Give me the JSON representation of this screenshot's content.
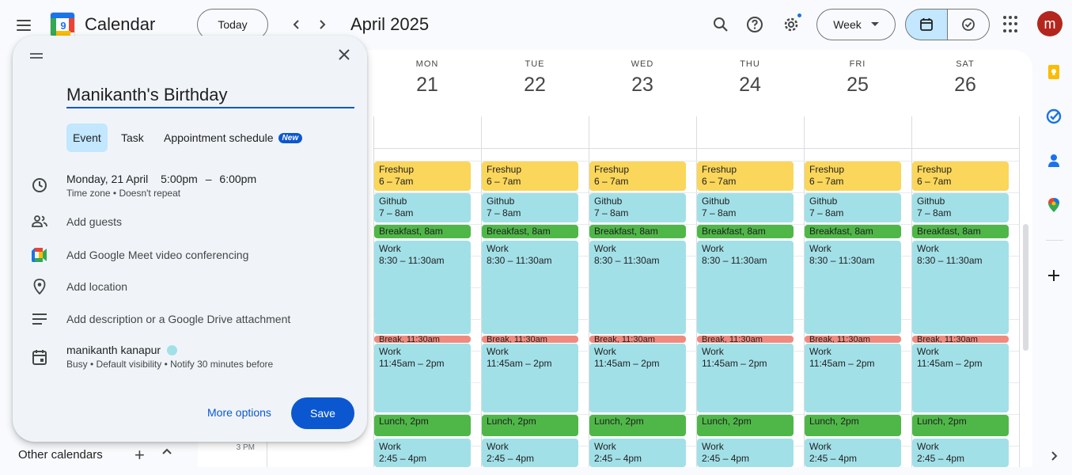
{
  "header": {
    "app_title": "Calendar",
    "logo_day": "9",
    "today_label": "Today",
    "month_title": "April 2025",
    "view_label": "Week",
    "avatar_letter": "m"
  },
  "days": [
    {
      "name": "MON",
      "num": "21"
    },
    {
      "name": "TUE",
      "num": "22"
    },
    {
      "name": "WED",
      "num": "23"
    },
    {
      "name": "THU",
      "num": "24"
    },
    {
      "name": "FRI",
      "num": "25"
    },
    {
      "name": "SAT",
      "num": "26"
    }
  ],
  "time_labels": [
    "3 PM"
  ],
  "events": [
    {
      "title": "Freshup",
      "time": "6 – 7am",
      "color": "yellow"
    },
    {
      "title": "Github",
      "time": "7 – 8am",
      "color": "cyan"
    },
    {
      "title": "Breakfast",
      "time": "8am",
      "color": "green"
    },
    {
      "title": "Work",
      "time": "8:30 – 11:30am",
      "color": "cyan"
    },
    {
      "title": "Break",
      "time": "11:30am",
      "color": "red"
    },
    {
      "title": "Work",
      "time": "11:45am – 2pm",
      "color": "cyan"
    },
    {
      "title": "Lunch",
      "time": "2pm",
      "color": "green"
    },
    {
      "title": "Work",
      "time": "2:45 – 4pm",
      "color": "cyan"
    }
  ],
  "event_colors": {
    "yellow": "#fad65b",
    "cyan": "#a2e0e8",
    "green": "#4fb748",
    "red": "#f08a7e"
  },
  "sidebar": {
    "other_calendars": "Other calendars"
  },
  "dialog": {
    "title_value": "Manikanth's Birthday",
    "tabs": [
      "Event",
      "Task",
      "Appointment schedule"
    ],
    "new_badge": "New",
    "date": "Monday, 21 April",
    "start_time": "5:00pm",
    "dash": "–",
    "end_time": "6:00pm",
    "timezone_text": "Time zone • Doesn't repeat",
    "add_guests": "Add guests",
    "add_meet": "Add Google Meet video conferencing",
    "add_location": "Add location",
    "add_description": "Add description or a Google Drive attachment",
    "calendar_owner": "manikanth kanapur",
    "calendar_details": "Busy • Default visibility • Notify 30 minutes before",
    "more_options": "More options",
    "save": "Save"
  }
}
